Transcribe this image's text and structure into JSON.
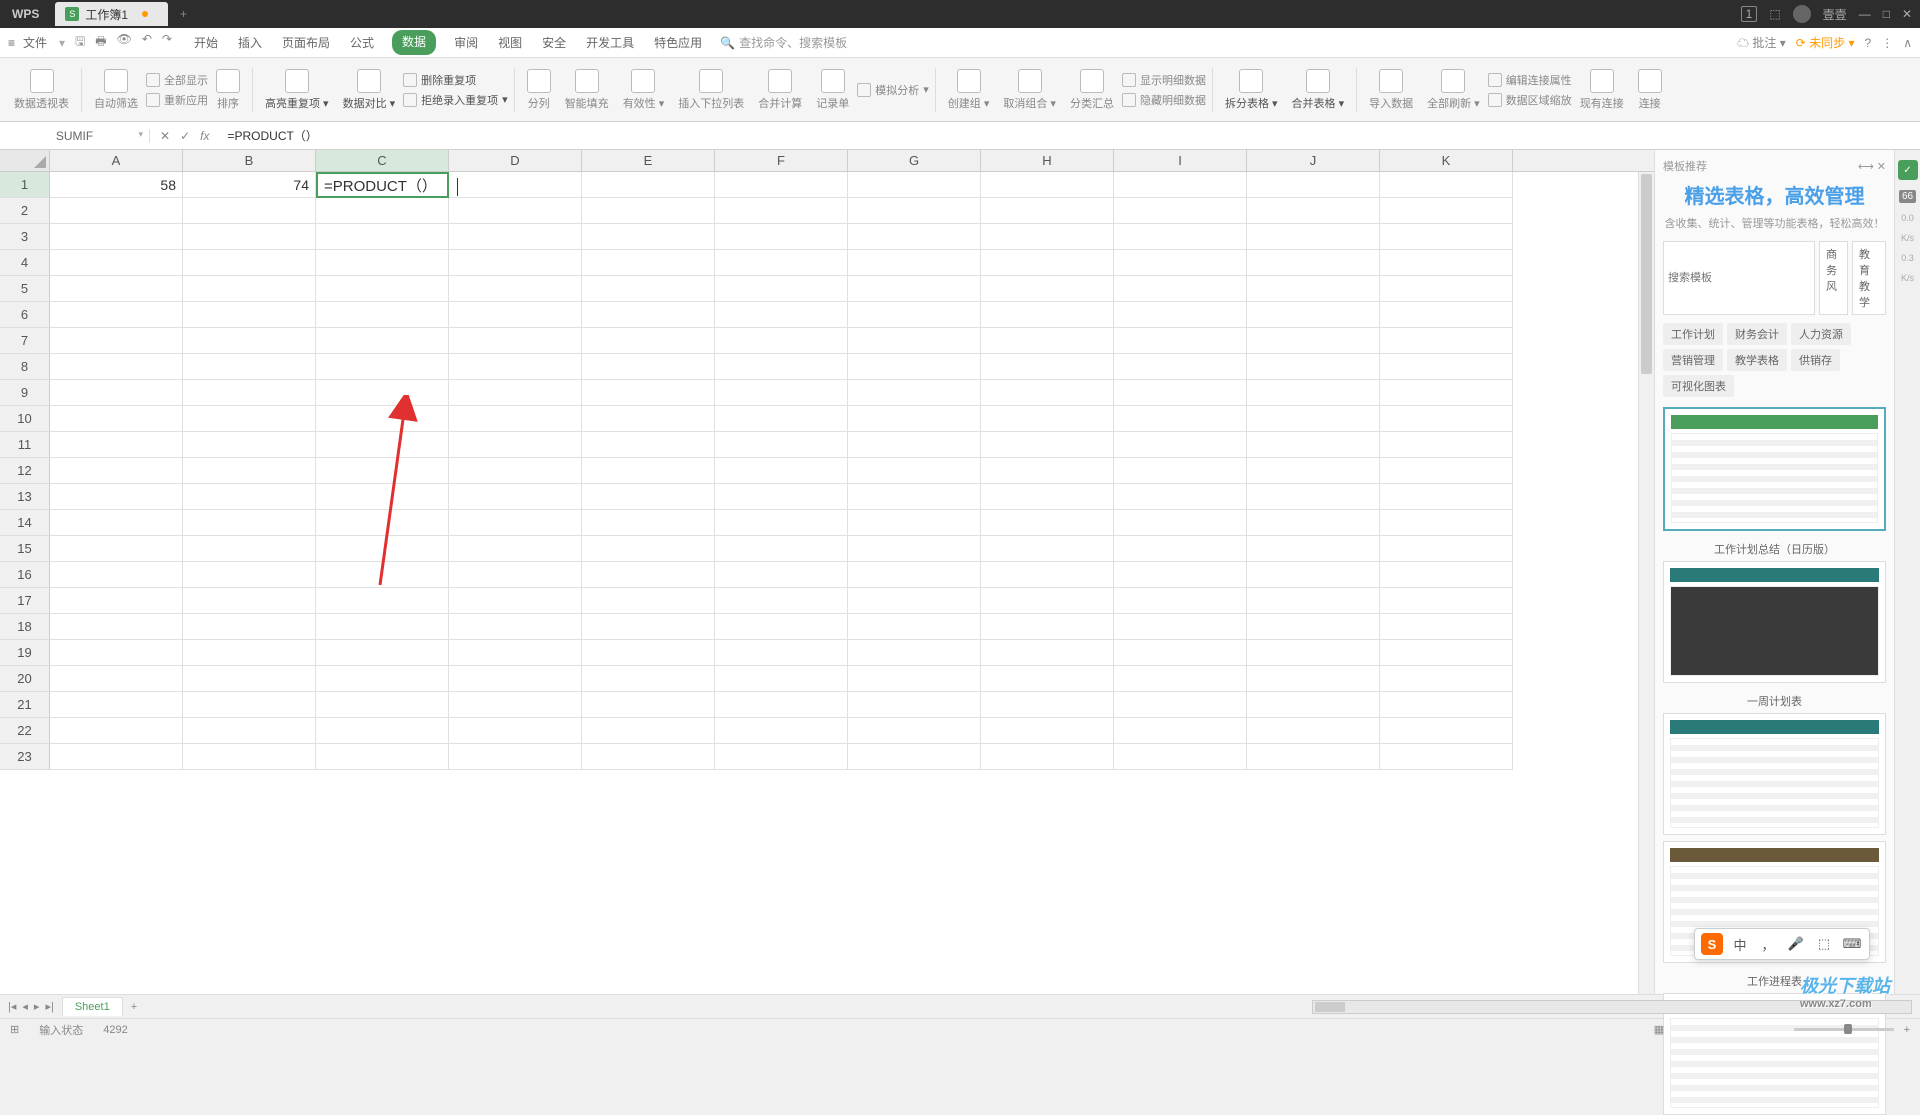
{
  "titlebar": {
    "app": "WPS",
    "tab_name": "工作簿1",
    "plus": "+",
    "num_badge": "1",
    "user": "壹壹"
  },
  "menubar": {
    "file": "文件",
    "tabs": [
      "开始",
      "插入",
      "页面布局",
      "公式",
      "数据",
      "审阅",
      "视图",
      "安全",
      "开发工具",
      "特色应用"
    ],
    "active_tab": "数据",
    "search_placeholder": "查找命令、搜索模板",
    "right": {
      "comment": "批注",
      "sync": "未同步"
    }
  },
  "ribbon": {
    "g1": "数据透视表",
    "g2": "自动筛选",
    "g2a": "全部显示",
    "g2b": "重新应用",
    "g3": "排序",
    "g4": "高亮重复项",
    "g5": "数据对比",
    "g6a": "删除重复项",
    "g6b": "拒绝录入重复项",
    "g7": "分列",
    "g8": "智能填充",
    "g9": "有效性",
    "g10": "插入下拉列表",
    "g11": "合并计算",
    "g12": "记录单",
    "g13a": "模拟分析",
    "g14": "创建组",
    "g15": "取消组合",
    "g16": "分类汇总",
    "g17a": "显示明细数据",
    "g17b": "隐藏明细数据",
    "g18": "拆分表格",
    "g19": "合并表格",
    "g20": "导入数据",
    "g21": "全部刷新",
    "g22a": "编辑连接属性",
    "g22b": "数据区域缩放",
    "g23": "现有连接",
    "g24": "连接"
  },
  "formula_bar": {
    "name_box": "SUMIF",
    "formula": "=PRODUCT（）"
  },
  "columns": [
    "A",
    "B",
    "C",
    "D",
    "E",
    "F",
    "G",
    "H",
    "I",
    "J",
    "K"
  ],
  "row_count": 23,
  "cells": {
    "A1": "58",
    "B1": "74",
    "C1": "=PRODUCT（）"
  },
  "active_cell": {
    "row": 1,
    "col": "C"
  },
  "right_panel": {
    "header": "模板推荐",
    "title": "精选表格，高效管理",
    "subtitle": "含收集、统计、管理等功能表格，轻松高效！",
    "search_placeholder": "搜索模板",
    "search_btns": [
      "商务风",
      "教育教学"
    ],
    "tags": [
      "工作计划",
      "财务会计",
      "人力资源",
      "营销管理",
      "教学表格",
      "供销存",
      "可视化图表"
    ],
    "thumbs": [
      {
        "label": "",
        "style": "green"
      },
      {
        "label": "工作计划总结（日历版）",
        "style": "dark"
      },
      {
        "label": "一周计划表",
        "style": ""
      },
      {
        "label": "",
        "style": "brown"
      },
      {
        "label": "工作进程表",
        "style": ""
      }
    ]
  },
  "side_strip": {
    "badge": "66",
    "v1": "0.0",
    "v2": "K/s",
    "v3": "0.3",
    "v4": "K/s"
  },
  "sheet_tabs": {
    "active": "Sheet1",
    "plus": "+"
  },
  "status_bar": {
    "mode": "输入状态",
    "count": "4292",
    "zoom": "100%"
  },
  "ime": [
    "中",
    "，",
    "🎤",
    "⬚",
    "⌨"
  ],
  "watermark": {
    "main": "极光下载站",
    "sub": "www.xz7.com"
  }
}
